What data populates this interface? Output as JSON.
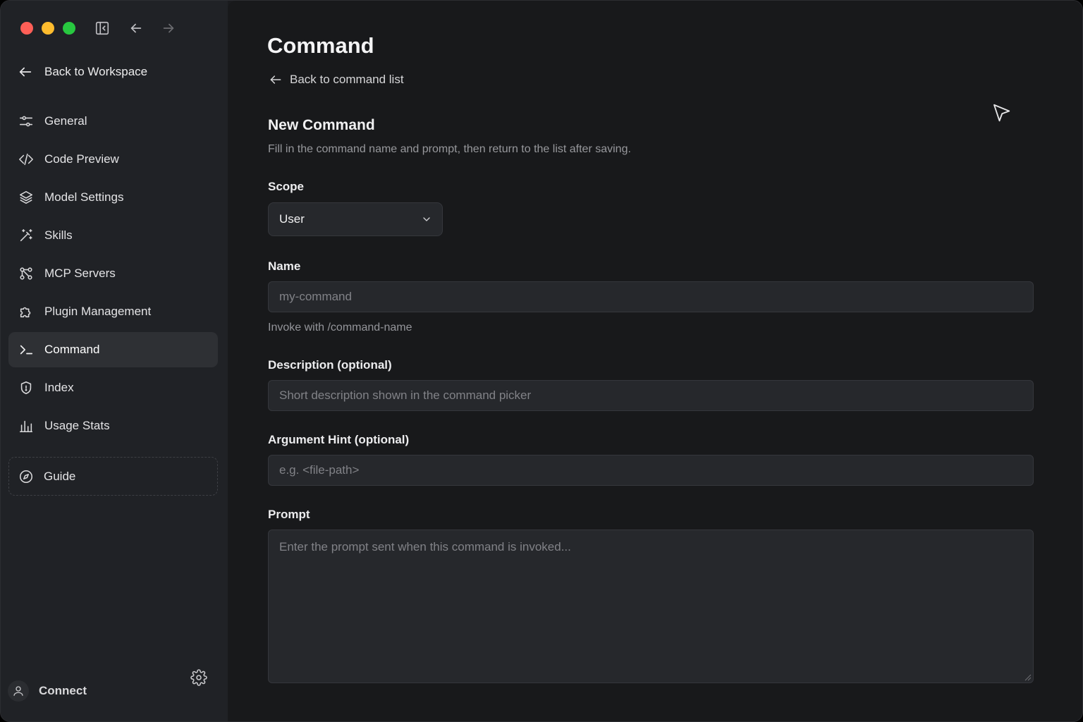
{
  "window": {
    "traffic_colors": {
      "close": "#ff5f57",
      "minimize": "#febc2e",
      "maximize": "#28c840"
    }
  },
  "sidebar": {
    "back_label": "Back to Workspace",
    "items": [
      {
        "label": "General",
        "icon": "sliders-icon"
      },
      {
        "label": "Code Preview",
        "icon": "code-icon"
      },
      {
        "label": "Model Settings",
        "icon": "layers-icon"
      },
      {
        "label": "Skills",
        "icon": "magic-wand-icon"
      },
      {
        "label": "MCP Servers",
        "icon": "nodes-icon"
      },
      {
        "label": "Plugin Management",
        "icon": "puzzle-icon"
      },
      {
        "label": "Command",
        "icon": "terminal-icon",
        "active": true
      },
      {
        "label": "Index",
        "icon": "shield-icon"
      },
      {
        "label": "Usage Stats",
        "icon": "bar-chart-icon"
      }
    ],
    "guide_label": "Guide",
    "user_label": "Connect"
  },
  "main": {
    "title": "Command",
    "back_label": "Back to command list",
    "section_title": "New Command",
    "section_desc": "Fill in the command name and prompt, then return to the list after saving.",
    "scope": {
      "label": "Scope",
      "value": "User"
    },
    "name": {
      "label": "Name",
      "placeholder": "my-command",
      "hint": "Invoke with /command-name"
    },
    "description": {
      "label": "Description (optional)",
      "placeholder": "Short description shown in the command picker"
    },
    "argument_hint": {
      "label": "Argument Hint (optional)",
      "placeholder": "e.g. <file-path>"
    },
    "prompt": {
      "label": "Prompt",
      "placeholder": "Enter the prompt sent when this command is invoked..."
    }
  }
}
